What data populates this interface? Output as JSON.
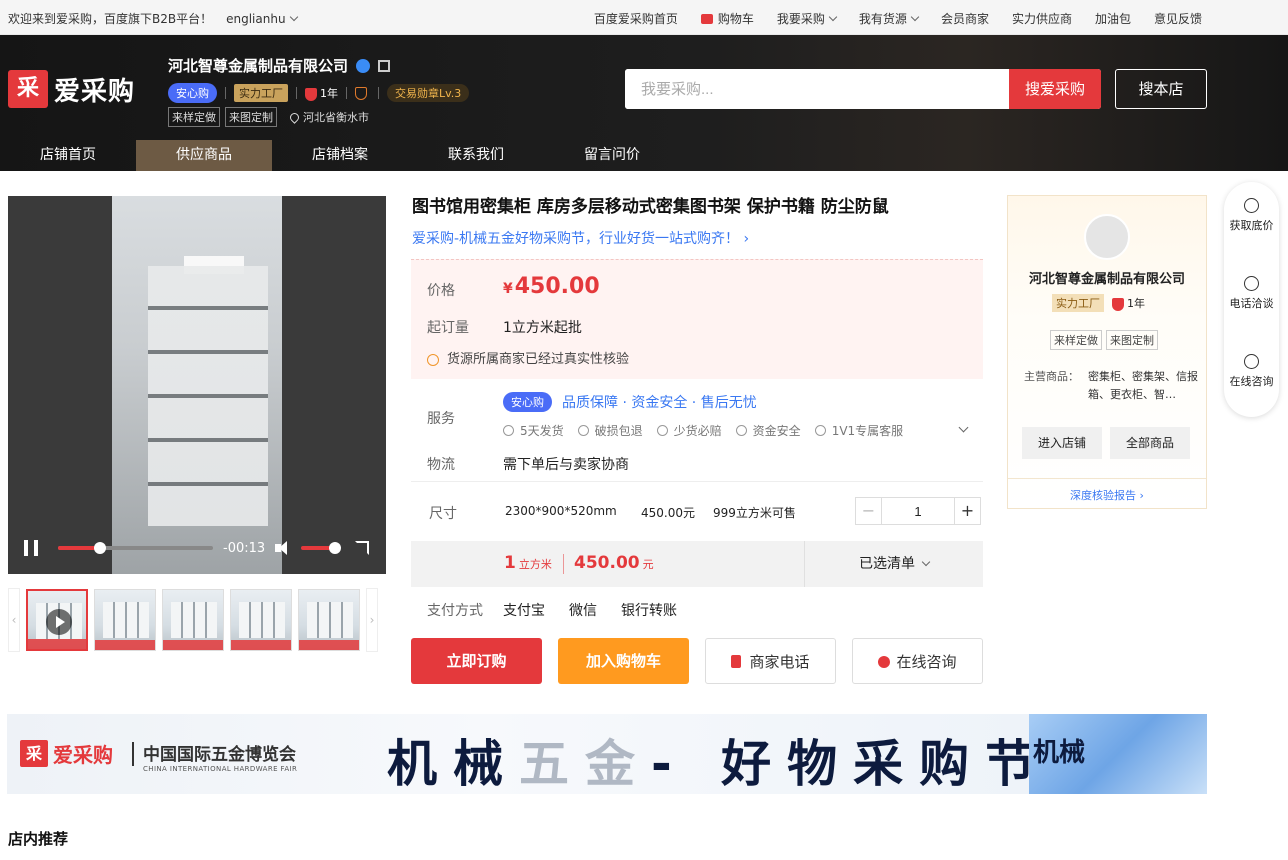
{
  "topbar": {
    "welcome": "欢迎来到爱采购，百度旗下B2B平台！",
    "user": "englianhu",
    "links": [
      {
        "label": "百度爱采购首页",
        "caret": false,
        "cart": false
      },
      {
        "label": "购物车",
        "caret": false,
        "cart": true
      },
      {
        "label": "我要采购",
        "caret": true,
        "cart": false
      },
      {
        "label": "我有货源",
        "caret": true,
        "cart": false
      },
      {
        "label": "会员商家",
        "caret": false,
        "cart": false
      },
      {
        "label": "实力供应商",
        "caret": false,
        "cart": false
      },
      {
        "label": "加油包",
        "caret": false,
        "cart": false
      },
      {
        "label": "意见反馈",
        "caret": false,
        "cart": false
      }
    ]
  },
  "header": {
    "logo_mark": "采",
    "logo_text": "爱采购",
    "shop_name": "河北智尊金属制品有限公司",
    "badge_anxin": "安心购",
    "badge_factory": "实力工厂",
    "badge_year": "1年",
    "badge_trade": "交易勋章Lv.3",
    "tags": [
      "来样定做",
      "来图定制"
    ],
    "location": "河北省衡水市",
    "search_placeholder": "我要采购...",
    "search_button": "搜爱采购",
    "search_store": "搜本店"
  },
  "nav": {
    "items": [
      "店铺首页",
      "供应商品",
      "店铺档案",
      "联系我们",
      "留言问价"
    ],
    "active": 1
  },
  "video": {
    "time": "-00:13",
    "progress": 0.27,
    "volume": 0.8
  },
  "product": {
    "title": "图书馆用密集柜 库房多层移动式密集图书架 保护书籍 防尘防鼠",
    "promo": "爱采购-机械五金好物采购节，行业好货一站式购齐！",
    "price_label": "价格",
    "currency": "¥",
    "price": "450.00",
    "moq_label": "起订量",
    "moq": "1立方米起批",
    "verified": "货源所属商家已经过真实性核验",
    "service_label": "服务",
    "service_badge": "安心购",
    "service_text": "品质保障 · 资金安全 · 售后无忧",
    "service_items": [
      "5天发货",
      "破损包退",
      "少货必赔",
      "资金安全",
      "1V1专属客服"
    ],
    "logistics_label": "物流",
    "logistics": "需下单后与卖家协商",
    "size_label": "尺寸",
    "size_spec": "2300*900*520mm",
    "size_price": "450.00元",
    "size_stock": "999立方米可售",
    "quantity": "1",
    "summary_qty": "1",
    "summary_qty_unit": "立方米",
    "summary_amount": "450.00",
    "summary_amount_unit": "元",
    "selected_list": "已选清单",
    "pay_label": "支付方式",
    "pay_methods": [
      "支付宝",
      "微信",
      "银行转账"
    ],
    "btn_buy": "立即订购",
    "btn_cart": "加入购物车",
    "btn_phone": "商家电话",
    "btn_chat": "在线咨询"
  },
  "shopcard": {
    "name": "河北智尊金属制品有限公司",
    "factory": "实力工厂",
    "year": "1年",
    "tags": [
      "来样定做",
      "来图定制"
    ],
    "main_label": "主营商品：",
    "main_value": "密集柜、密集架、信报箱、更衣柜、智…",
    "btn_enter": "进入店铺",
    "btn_all": "全部商品",
    "report": "深度核验报告"
  },
  "floatbar": {
    "items": [
      "获取底价",
      "电话洽谈",
      "在线咨询"
    ]
  },
  "banner": {
    "logo_text": "爱采购",
    "fair_cn": "中国国际五金博览会",
    "fair_en": "CHINA INTERNATIONAL HARDWARE FAIR",
    "slogan_a": "机械",
    "slogan_b": "五金",
    "slogan_c": "- 好物采购节",
    "cube_text": "机械"
  },
  "section": {
    "recommend": "店内推荐"
  }
}
